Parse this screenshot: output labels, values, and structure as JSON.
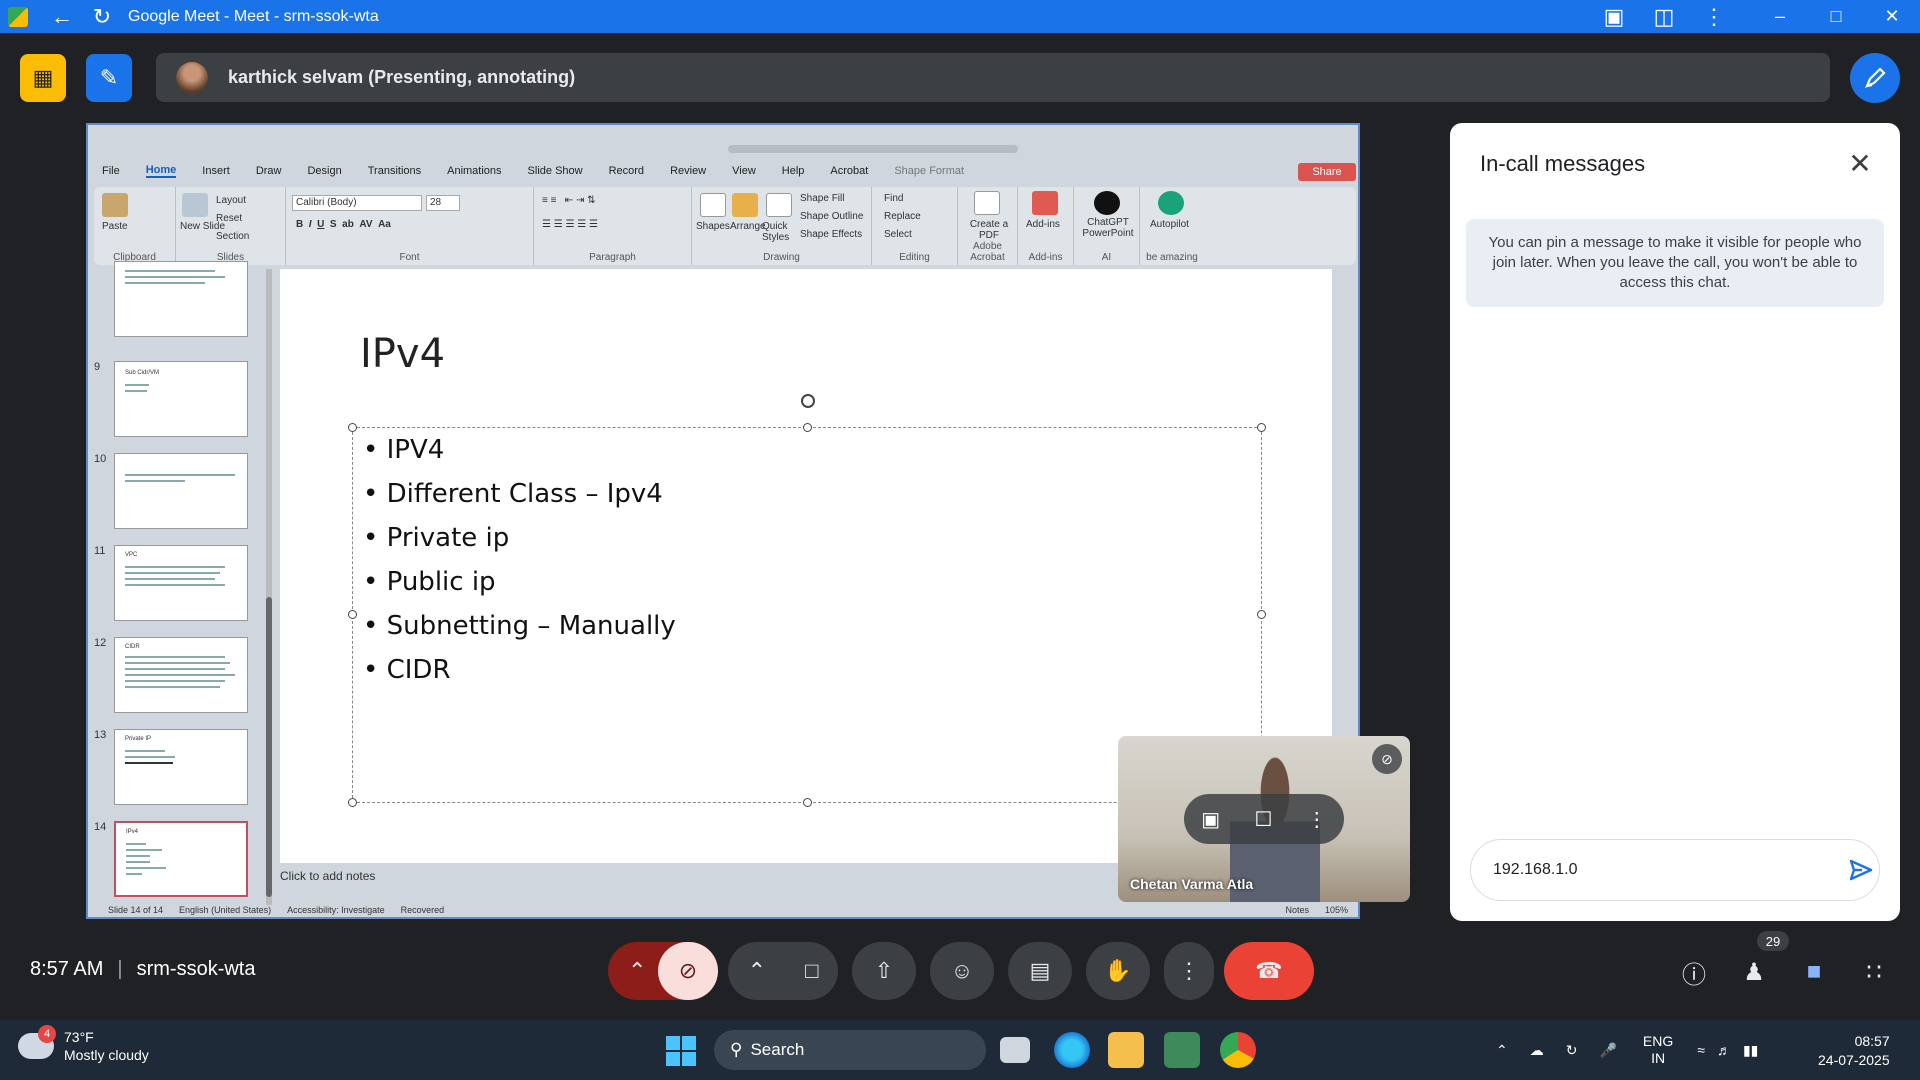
{
  "window": {
    "title": "Google Meet - Meet - srm-ssok-wta"
  },
  "presenter": {
    "name": "karthick selvam (Presenting, annotating)"
  },
  "ppt": {
    "tabs": [
      "File",
      "Home",
      "Insert",
      "Draw",
      "Design",
      "Transitions",
      "Animations",
      "Slide Show",
      "Record",
      "Review",
      "View",
      "Help",
      "Acrobat",
      "Shape Format"
    ],
    "share_label": "Share",
    "ribbon": {
      "paste": "Paste",
      "clipboard": "Clipboard",
      "new_slide": "New Slide",
      "layout": "Layout",
      "reset": "Reset",
      "section": "Section",
      "slides": "Slides",
      "font_name": "Calibri (Body)",
      "font_size": "28",
      "font": "Font",
      "paragraph": "Paragraph",
      "shapes": "Shapes",
      "arrange": "Arrange",
      "quick_styles": "Quick Styles",
      "shape_fill": "Shape Fill",
      "shape_outline": "Shape Outline",
      "shape_effects": "Shape Effects",
      "drawing": "Drawing",
      "find": "Find",
      "replace": "Replace",
      "select": "Select",
      "editing": "Editing",
      "create_pdf": "Create a PDF",
      "adobe_acrobat": "Adobe Acrobat",
      "addins": "Add-ins",
      "addins_group": "Add-ins",
      "chatgpt": "ChatGPT PowerPoint",
      "ai": "AI",
      "autopilot": "Autopilot",
      "be_amazing": "be amazing"
    },
    "thumbnails": [
      {
        "num": "",
        "title": ""
      },
      {
        "num": "9",
        "title": "Sub Cidr/VM"
      },
      {
        "num": "10",
        "title": ""
      },
      {
        "num": "11",
        "title": "VPC"
      },
      {
        "num": "12",
        "title": "CIDR"
      },
      {
        "num": "13",
        "title": "Private IP"
      },
      {
        "num": "14",
        "title": "IPv4"
      }
    ],
    "slide": {
      "title": "IPv4",
      "bullets": [
        "IPV4",
        "Different Class – Ipv4",
        "Private ip",
        "Public ip",
        "Subnetting – Manually",
        "CIDR"
      ]
    },
    "notes_placeholder": "Click to add notes",
    "status": {
      "slide": "Slide 14 of 14",
      "language": "English (United States)",
      "accessibility": "Accessibility: Investigate",
      "recovered": "Recovered",
      "notes": "Notes",
      "zoom": "105%"
    }
  },
  "selfview": {
    "name": "Chetan Varma Atla"
  },
  "chat": {
    "title": "In-call messages",
    "notice": "You can pin a message to make it visible for people who join later. When you leave the call, you won't be able to access this chat.",
    "input_value": "192.168.1.0"
  },
  "meeting": {
    "time": "8:57 AM",
    "code": "srm-ssok-wta",
    "participants_count": "29"
  },
  "taskbar": {
    "weather_badge": "4",
    "temperature": "73°F",
    "condition": "Mostly cloudy",
    "search": "Search",
    "lang": "ENG",
    "region": "IN",
    "clock_time": "08:57",
    "clock_date": "24-07-2025"
  },
  "colors": {
    "titlebar": "#1a73e8",
    "meet_bg": "#202124",
    "end_call": "#ea4335",
    "mic_off": "#f9dedc",
    "present_yellow": "#fbbc04"
  }
}
